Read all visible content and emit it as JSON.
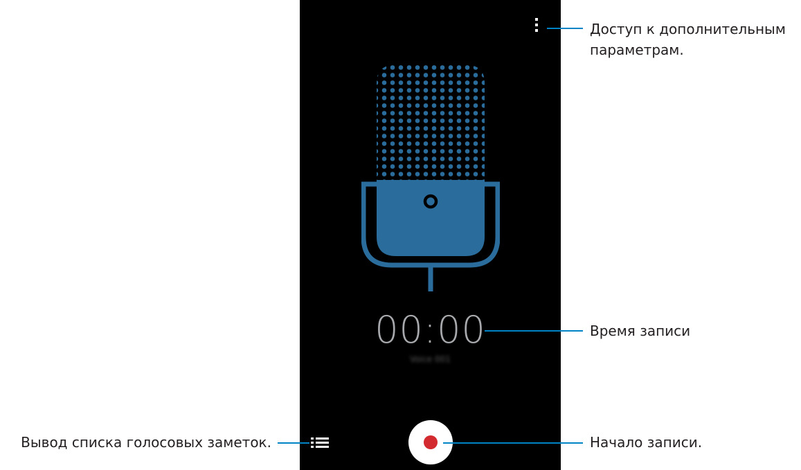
{
  "screen": {
    "timer": "00:00",
    "file_name": "Voice 001"
  },
  "icons": {
    "more_options": "more-vertical-icon",
    "microphone": "microphone-icon",
    "recordings_list": "list-icon",
    "record": "record-icon"
  },
  "callouts": {
    "more_options": {
      "line1": "Доступ к дополнительным",
      "line2": "параметрам."
    },
    "recording_time": "Время записи",
    "recordings_list": "Вывод списка голосовых заметок.",
    "start_recording": "Начало записи."
  },
  "colors": {
    "screen_background": "#000000",
    "microphone": "#2a6d9c",
    "timer_text": "#a7a9ac",
    "record_dot": "#d22a2f",
    "callout_line": "#0084c6"
  }
}
